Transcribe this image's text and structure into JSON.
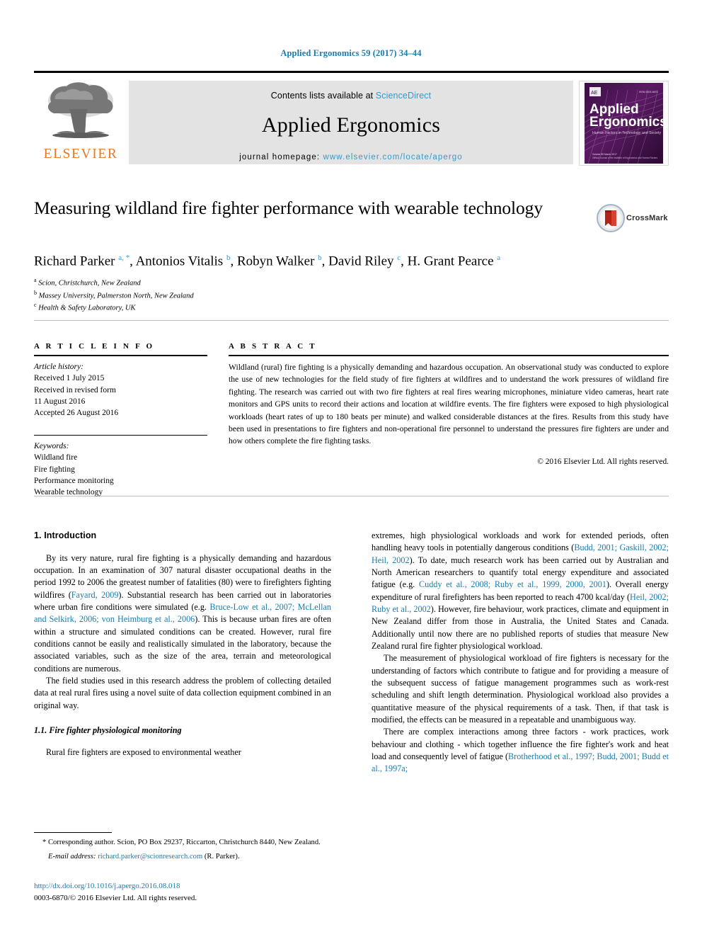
{
  "running_head": "Applied Ergonomics 59 (2017) 34–44",
  "banner": {
    "contents_prefix": "Contents lists available at",
    "contents_link": "ScienceDirect",
    "journal_name": "Applied Ergonomics",
    "homepage_prefix": "journal homepage:",
    "homepage_url": "www.elsevier.com/locate/apergo",
    "publisher_logo_text": "ELSEVIER",
    "cover": {
      "title_line1": "Applied",
      "title_line2": "Ergonomics",
      "subtitle": "Human Factors in Technology and Society",
      "volume_note": "Volume 59 March 2017",
      "issn_note": "ISSN 0003-6870"
    }
  },
  "article": {
    "title": "Measuring wildland fire fighter performance with wearable technology",
    "crossmark_label": "CrossMark",
    "authors_html": "Richard Parker <sup>a, *</sup>, Antonios Vitalis <sup>b</sup>, Robyn Walker <sup>b</sup>, David Riley <sup>c</sup>, H. Grant Pearce <sup>a</sup>",
    "affiliations": [
      {
        "marker": "a",
        "text": "Scion, Christchurch, New Zealand"
      },
      {
        "marker": "b",
        "text": "Massey University, Palmerston North, New Zealand"
      },
      {
        "marker": "c",
        "text": "Health & Safety Laboratory, UK"
      }
    ]
  },
  "article_info": {
    "heading": "A R T I C L E  I N F O",
    "history_title": "Article history:",
    "history": [
      "Received 1 July 2015",
      "Received in revised form",
      "11 August 2016",
      "Accepted 26 August 2016"
    ],
    "keywords_title": "Keywords:",
    "keywords": [
      "Wildland fire",
      "Fire fighting",
      "Performance monitoring",
      "Wearable technology"
    ]
  },
  "abstract": {
    "heading": "A B S T R A C T",
    "text": "Wildland (rural) fire fighting is a physically demanding and hazardous occupation. An observational study was conducted to explore the use of new technologies for the field study of fire fighters at wildfires and to understand the work pressures of wildland fire fighting. The research was carried out with two fire fighters at real fires wearing microphones, miniature video cameras, heart rate monitors and GPS units to record their actions and location at wildfire events. The fire fighters were exposed to high physiological workloads (heart rates of up to 180 beats per minute) and walked considerable distances at the fires. Results from this study have been used in presentations to fire fighters and non-operational fire personnel to understand the pressures fire fighters are under and how others complete the fire fighting tasks.",
    "copyright": "© 2016 Elsevier Ltd. All rights reserved."
  },
  "body": {
    "section1_heading": "1. Introduction",
    "p1_a": "By its very nature, rural fire fighting is a physically demanding and hazardous occupation. In an examination of 307 natural disaster occupational deaths in the period 1992 to 2006 the greatest number of fatalities (80) were to firefighters fighting wildfires (",
    "p1_ref1": "Fayard, 2009",
    "p1_b": "). Substantial research has been carried out in laboratories where urban fire conditions were simulated (e.g. ",
    "p1_ref2": "Bruce-Low et al., 2007; McLellan and Selkirk, 2006; von Heimburg et al., 2006",
    "p1_c": "). This is because urban fires are often within a structure and simulated conditions can be created. However, rural fire conditions cannot be easily and realistically simulated in the laboratory, because the associated variables, such as the size of the area, terrain and meteorological conditions are numerous.",
    "p2": "The field studies used in this research address the problem of collecting detailed data at real rural fires using a novel suite of data collection equipment combined in an original way.",
    "section11_heading": "1.1. Fire fighter physiological monitoring",
    "p3": "Rural fire fighters are exposed to environmental weather",
    "r_p1_a": "extremes, high physiological workloads and work for extended periods, often handling heavy tools in potentially dangerous conditions (",
    "r_p1_ref1": "Budd, 2001; Gaskill, 2002; Heil, 2002",
    "r_p1_b": "). To date, much research work has been carried out by Australian and North American researchers to quantify total energy expenditure and associated fatigue (e.g. ",
    "r_p1_ref2": "Cuddy et al., 2008; Ruby et al., 1999, 2000, 2001",
    "r_p1_c": "). Overall energy expenditure of rural firefighters has been reported to reach 4700 kcal/day (",
    "r_p1_ref3": "Heil, 2002; Ruby et al., 2002",
    "r_p1_d": "). However, fire behaviour, work practices, climate and equipment in New Zealand differ from those in Australia, the United States and Canada. Additionally until now there are no published reports of studies that measure New Zealand rural fire fighter physiological workload.",
    "r_p2": "The measurement of physiological workload of fire fighters is necessary for the understanding of factors which contribute to fatigue and for providing a measure of the subsequent success of fatigue management programmes such as work-rest scheduling and shift length determination. Physiological workload also provides a quantitative measure of the physical requirements of a task. Then, if that task is modified, the effects can be measured in a repeatable and unambiguous way.",
    "r_p3_a": "There are complex interactions among three factors - work practices, work behaviour and clothing - which together influence the fire fighter's work and heat load and consequently level of fatigue (",
    "r_p3_ref1": "Brotherhood et al., 1997; Budd, 2001; Budd et al., 1997a;"
  },
  "footnote": {
    "corresponding": "* Corresponding author. Scion, PO Box 29237, Riccarton, Christchurch 8440, New Zealand.",
    "email_label": "E-mail address:",
    "email": "richard.parker@scionresearch.com",
    "email_attrib": "(R. Parker)."
  },
  "doi_block": {
    "doi": "http://dx.doi.org/10.1016/j.apergo.2016.08.018",
    "issn": "0003-6870/© 2016 Elsevier Ltd. All rights reserved."
  },
  "colors": {
    "link_blue": "#1a7cae",
    "sciencedirect_blue": "#2e9ad0",
    "elsevier_orange": "#e87722",
    "band_gray": "#e3e3e3"
  }
}
